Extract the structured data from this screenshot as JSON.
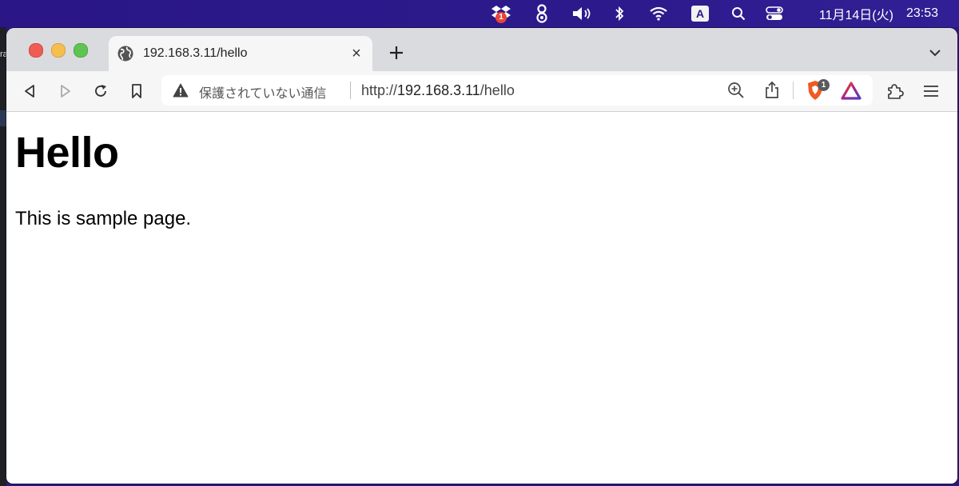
{
  "menubar": {
    "dropbox_badge": "1",
    "input_source": "A",
    "date": "11月14日(火)",
    "time": "23:53",
    "icons": [
      "dropbox-icon",
      "klack-icon",
      "volume-icon",
      "bluetooth-icon",
      "wifi-icon",
      "input-source-icon",
      "spotlight-icon",
      "control-center-icon"
    ]
  },
  "left_sliver": {
    "text": "ra"
  },
  "tab": {
    "title": "192.168.3.11/hello",
    "close": "×"
  },
  "toolbar": {
    "security_label": "保護されていない通信",
    "url_scheme": "http://",
    "url_host": "192.168.3.11",
    "url_path": "/hello",
    "shields_badge": "1"
  },
  "page": {
    "heading": "Hello",
    "paragraph": "This is sample page."
  },
  "colors": {
    "menubar": "#2a1686",
    "tabstrip": "#dadbde",
    "toolbar": "#f6f6f7",
    "brave_orange": "#f15a24"
  }
}
